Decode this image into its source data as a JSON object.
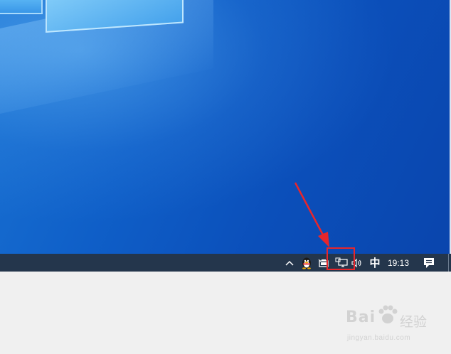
{
  "taskbar": {
    "tray": {
      "chevron_glyph": "^",
      "ime_label": "中",
      "clock": "19:13",
      "icons": [
        "chevron-up-icon",
        "qq-penguin-icon",
        "battery-icon",
        "network-monitor-icon",
        "volume-icon",
        "notification-icon"
      ]
    }
  },
  "annotation": {
    "box_color": "#e8262b",
    "arrow_color": "#e8262b"
  },
  "watermark": {
    "brand": "Bai",
    "product": "经验",
    "url": "jingyan.baidu.com"
  },
  "colors": {
    "taskbar": "#24364c",
    "desktop": "#0f5fc8",
    "below": "#f0f0f0"
  }
}
